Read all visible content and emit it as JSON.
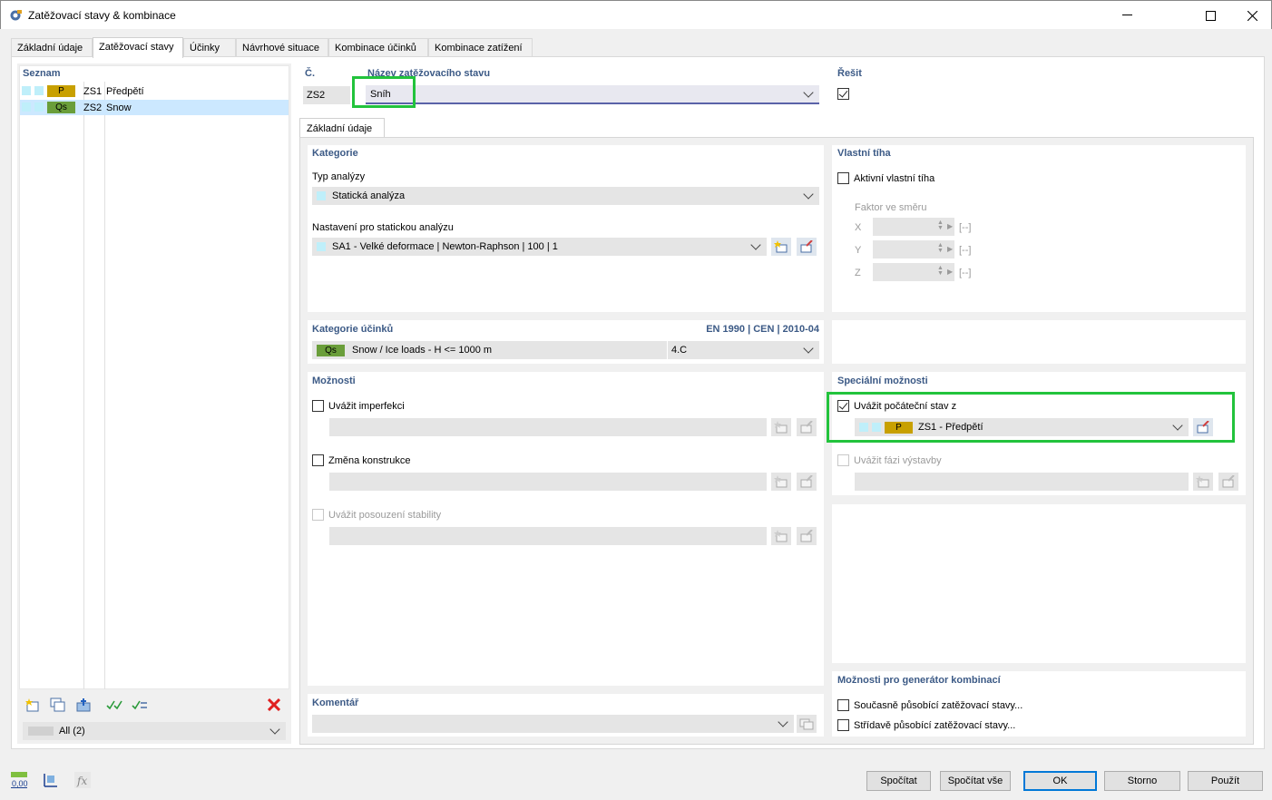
{
  "window": {
    "title": "Zatěžovací stavy & kombinace"
  },
  "tabs": [
    "Základní údaje",
    "Zatěžovací stavy",
    "Účinky",
    "Návrhové situace",
    "Kombinace účinků",
    "Kombinace zatížení"
  ],
  "list": {
    "header": "Seznam",
    "items": [
      {
        "badge": "P",
        "id": "ZS1",
        "name": "Předpětí"
      },
      {
        "badge": "Qs",
        "id": "ZS2",
        "name": "Snow"
      }
    ],
    "filter": "All (2)"
  },
  "top": {
    "no_label": "Č.",
    "no_value": "ZS2",
    "name_label": "Název zatěžovacího stavu",
    "name_value": "Sníh",
    "solve_label": "Řešit"
  },
  "subtab": "Základní údaje",
  "category": {
    "header": "Kategorie",
    "analysis_label": "Typ analýzy",
    "analysis_value": "Statická analýza",
    "settings_label": "Nastavení pro statickou analýzu",
    "settings_value": "SA1 - Velké deformace | Newton-Raphson | 100 | 1"
  },
  "self_weight": {
    "header": "Vlastní tíha",
    "active_label": "Aktivní vlastní tíha",
    "factor_label": "Faktor ve směru",
    "axes": [
      "X",
      "Y",
      "Z"
    ],
    "unit": "[--]"
  },
  "action_category": {
    "header": "Kategorie účinků",
    "norm": "EN 1990 | CEN | 2010-04",
    "badge": "Qs",
    "value": "Snow / Ice loads - H <= 1000 m",
    "code": "4.C"
  },
  "options": {
    "header": "Možnosti",
    "imperfection": "Uvážit imperfekci",
    "structure_change": "Změna konstrukce",
    "stability": "Uvážit posouzení stability"
  },
  "special": {
    "header": "Speciální možnosti",
    "initial_state": "Uvážit počáteční stav z",
    "initial_badge": "P",
    "initial_value": "ZS1 - Předpětí",
    "phase": "Uvážit fázi výstavby"
  },
  "combo_gen": {
    "header": "Možnosti pro generátor kombinací",
    "simultaneous": "Současně působící zatěžovací stavy...",
    "alternating": "Střídavě působící zatěžovací stavy..."
  },
  "comment": {
    "header": "Komentář"
  },
  "buttons": {
    "calc": "Spočítat",
    "calc_all": "Spočítat vše",
    "ok": "OK",
    "cancel": "Storno",
    "apply": "Použít"
  },
  "bottom_icons": {
    "zero_label": "0,00"
  },
  "colors": {
    "badge_p": "#c8a000",
    "badge_qs": "#6a9e3a",
    "highlight": "#22c33c",
    "header": "#3c5a86"
  }
}
